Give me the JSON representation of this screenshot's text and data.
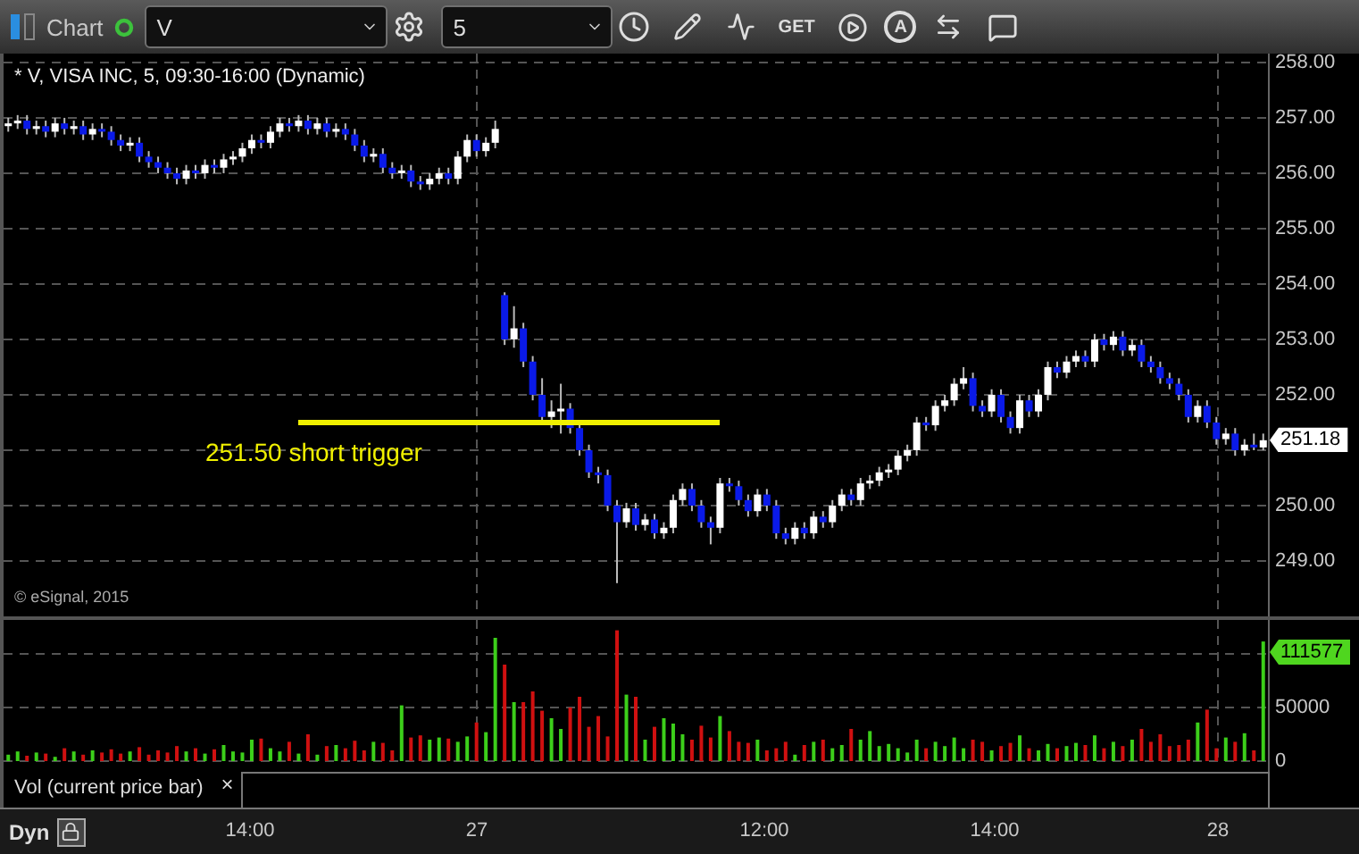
{
  "toolbar": {
    "title": "Chart",
    "connected": true,
    "symbol": "V",
    "interval": "5",
    "get_label": "GET",
    "alert_label": "A"
  },
  "chart": {
    "title": "* V, VISA INC, 5, 09:30-16:00 (Dynamic)",
    "copyright": "© eSignal, 2015",
    "annotation": "251.50 short trigger",
    "last_price": "251.18",
    "chart_data": {
      "type": "candlestick",
      "ylim": [
        248,
        258.16
      ],
      "grid": true,
      "yticks": [
        {
          "value": 258,
          "label": "258.00"
        },
        {
          "value": 257,
          "label": "257.00"
        },
        {
          "value": 256,
          "label": "256.00"
        },
        {
          "value": 255,
          "label": "255.00"
        },
        {
          "value": 254,
          "label": "254.00"
        },
        {
          "value": 253,
          "label": "253.00"
        },
        {
          "value": 252,
          "label": "252.00"
        },
        {
          "value": 250,
          "label": "250.00"
        },
        {
          "value": 249,
          "label": "249.00"
        }
      ],
      "categories": [
        null,
        null,
        null,
        null,
        null,
        null,
        null,
        null,
        null,
        null,
        null,
        null,
        null,
        null,
        null,
        null,
        null,
        null,
        null,
        null,
        null,
        null,
        null,
        null,
        null,
        null,
        null,
        null,
        null,
        null,
        null,
        null,
        null,
        null,
        null,
        null,
        null,
        null,
        null,
        null,
        null,
        null,
        null,
        null,
        null,
        null,
        null,
        null,
        null,
        null,
        null,
        null,
        null,
        null,
        null,
        null,
        null,
        null,
        null,
        null,
        null,
        null,
        null,
        null,
        null,
        null,
        null,
        null,
        null,
        null,
        null,
        null,
        null,
        null,
        null,
        null,
        null,
        null,
        null,
        null,
        null,
        null,
        null,
        null,
        null,
        null,
        null,
        null,
        null,
        null,
        null,
        null,
        null,
        null,
        null,
        null,
        null,
        null,
        null,
        null,
        null,
        null,
        null,
        null,
        null,
        null,
        null,
        null,
        null,
        null,
        null,
        null,
        null,
        null,
        null,
        null,
        null,
        null,
        null,
        null,
        null,
        null,
        null,
        null,
        null,
        null,
        null,
        null,
        null,
        null,
        null,
        null,
        null,
        null,
        null
      ],
      "ohlc": [
        [
          256.85,
          257.0,
          256.75,
          256.9
        ],
        [
          256.9,
          257.05,
          256.8,
          256.95
        ],
        [
          256.95,
          257.05,
          256.7,
          256.8
        ],
        [
          256.8,
          256.95,
          256.7,
          256.85
        ],
        [
          256.85,
          256.95,
          256.65,
          256.75
        ],
        [
          256.75,
          257.0,
          256.65,
          256.9
        ],
        [
          256.9,
          257.0,
          256.7,
          256.8
        ],
        [
          256.8,
          256.95,
          256.7,
          256.85
        ],
        [
          256.85,
          256.95,
          256.6,
          256.7
        ],
        [
          256.7,
          256.9,
          256.6,
          256.8
        ],
        [
          256.8,
          256.9,
          256.65,
          256.75
        ],
        [
          256.75,
          256.85,
          256.5,
          256.6
        ],
        [
          256.6,
          256.7,
          256.4,
          256.5
        ],
        [
          256.5,
          256.65,
          256.4,
          256.55
        ],
        [
          256.55,
          256.65,
          256.2,
          256.3
        ],
        [
          256.3,
          256.4,
          256.1,
          256.2
        ],
        [
          256.2,
          256.3,
          256.0,
          256.1
        ],
        [
          256.1,
          256.2,
          255.9,
          256.0
        ],
        [
          256.0,
          256.1,
          255.8,
          255.9
        ],
        [
          255.9,
          256.15,
          255.8,
          256.05
        ],
        [
          256.05,
          256.15,
          255.9,
          256.0
        ],
        [
          256.0,
          256.25,
          255.9,
          256.15
        ],
        [
          256.15,
          256.25,
          256.0,
          256.1
        ],
        [
          256.1,
          256.35,
          256.0,
          256.25
        ],
        [
          256.25,
          256.4,
          256.15,
          256.3
        ],
        [
          256.3,
          256.55,
          256.2,
          256.45
        ],
        [
          256.45,
          256.7,
          256.35,
          256.6
        ],
        [
          256.6,
          256.7,
          256.45,
          256.55
        ],
        [
          256.55,
          256.85,
          256.45,
          256.75
        ],
        [
          256.75,
          257.0,
          256.65,
          256.9
        ],
        [
          256.9,
          257.0,
          256.75,
          256.85
        ],
        [
          256.85,
          257.05,
          256.75,
          256.95
        ],
        [
          256.95,
          257.05,
          256.7,
          256.8
        ],
        [
          256.8,
          257.0,
          256.7,
          256.9
        ],
        [
          256.9,
          257.0,
          256.65,
          256.75
        ],
        [
          256.75,
          256.9,
          256.65,
          256.8
        ],
        [
          256.8,
          256.9,
          256.6,
          256.7
        ],
        [
          256.7,
          256.8,
          256.4,
          256.5
        ],
        [
          256.5,
          256.6,
          256.2,
          256.3
        ],
        [
          256.3,
          256.45,
          256.2,
          256.35
        ],
        [
          256.35,
          256.45,
          256.0,
          256.1
        ],
        [
          256.1,
          256.2,
          255.9,
          256.0
        ],
        [
          256.0,
          256.15,
          255.9,
          256.05
        ],
        [
          256.05,
          256.15,
          255.75,
          255.85
        ],
        [
          255.85,
          255.95,
          255.7,
          255.8
        ],
        [
          255.8,
          256.0,
          255.7,
          255.9
        ],
        [
          255.9,
          256.1,
          255.8,
          256.0
        ],
        [
          256.0,
          256.1,
          255.8,
          255.9
        ],
        [
          255.9,
          256.4,
          255.8,
          256.3
        ],
        [
          256.3,
          256.7,
          256.2,
          256.6
        ],
        [
          256.6,
          256.7,
          256.3,
          256.4
        ],
        [
          256.4,
          256.65,
          256.3,
          256.55
        ],
        [
          256.55,
          256.95,
          256.45,
          256.8
        ],
        [
          253.8,
          253.85,
          252.9,
          253.0
        ],
        [
          253.0,
          253.6,
          252.85,
          253.2
        ],
        [
          253.2,
          253.3,
          252.5,
          252.6
        ],
        [
          252.6,
          252.7,
          251.9,
          252.0
        ],
        [
          252.0,
          252.3,
          251.5,
          251.6
        ],
        [
          251.6,
          251.9,
          251.4,
          251.7
        ],
        [
          251.7,
          252.2,
          251.3,
          251.75
        ],
        [
          251.75,
          251.85,
          251.3,
          251.4
        ],
        [
          251.4,
          251.5,
          250.9,
          251.0
        ],
        [
          251.0,
          251.1,
          250.5,
          250.6
        ],
        [
          250.6,
          250.7,
          250.4,
          250.55
        ],
        [
          250.55,
          250.65,
          249.9,
          250.0
        ],
        [
          250.0,
          250.1,
          248.6,
          249.7
        ],
        [
          249.7,
          250.05,
          249.6,
          249.95
        ],
        [
          249.95,
          250.05,
          249.55,
          249.65
        ],
        [
          249.65,
          249.85,
          249.55,
          249.75
        ],
        [
          249.75,
          249.85,
          249.4,
          249.5
        ],
        [
          249.5,
          249.7,
          249.4,
          249.6
        ],
        [
          249.6,
          250.2,
          249.5,
          250.1
        ],
        [
          250.1,
          250.4,
          250.0,
          250.3
        ],
        [
          250.3,
          250.4,
          249.9,
          250.0
        ],
        [
          250.0,
          250.1,
          249.6,
          249.7
        ],
        [
          249.7,
          249.8,
          249.3,
          249.6
        ],
        [
          249.6,
          250.5,
          249.5,
          250.4
        ],
        [
          250.4,
          250.5,
          250.25,
          250.35
        ],
        [
          250.35,
          250.45,
          250.0,
          250.1
        ],
        [
          250.1,
          250.2,
          249.8,
          249.9
        ],
        [
          249.9,
          250.3,
          249.8,
          250.2
        ],
        [
          250.2,
          250.3,
          249.9,
          250.0
        ],
        [
          250.0,
          250.1,
          249.4,
          249.5
        ],
        [
          249.5,
          249.6,
          249.3,
          249.4
        ],
        [
          249.4,
          249.7,
          249.3,
          249.6
        ],
        [
          249.6,
          249.7,
          249.4,
          249.5
        ],
        [
          249.5,
          249.9,
          249.4,
          249.8
        ],
        [
          249.8,
          249.9,
          249.6,
          249.7
        ],
        [
          249.7,
          250.1,
          249.6,
          250.0
        ],
        [
          250.0,
          250.3,
          249.9,
          250.2
        ],
        [
          250.2,
          250.3,
          250.0,
          250.1
        ],
        [
          250.1,
          250.5,
          250.0,
          250.4
        ],
        [
          250.4,
          250.55,
          250.3,
          250.45
        ],
        [
          250.45,
          250.7,
          250.35,
          250.6
        ],
        [
          250.6,
          250.75,
          250.5,
          250.65
        ],
        [
          250.65,
          251.0,
          250.55,
          250.9
        ],
        [
          250.9,
          251.1,
          250.8,
          251.0
        ],
        [
          251.0,
          251.6,
          250.9,
          251.5
        ],
        [
          251.5,
          251.6,
          251.35,
          251.45
        ],
        [
          251.45,
          251.9,
          251.35,
          251.8
        ],
        [
          251.8,
          252.0,
          251.7,
          251.9
        ],
        [
          251.9,
          252.3,
          251.8,
          252.2
        ],
        [
          252.2,
          252.5,
          252.1,
          252.3
        ],
        [
          252.3,
          252.4,
          251.7,
          251.8
        ],
        [
          251.8,
          251.9,
          251.6,
          251.7
        ],
        [
          251.7,
          252.1,
          251.6,
          252.0
        ],
        [
          252.0,
          252.1,
          251.5,
          251.6
        ],
        [
          251.6,
          251.7,
          251.3,
          251.4
        ],
        [
          251.4,
          252.0,
          251.3,
          251.9
        ],
        [
          251.9,
          252.0,
          251.6,
          251.7
        ],
        [
          251.7,
          252.1,
          251.6,
          252.0
        ],
        [
          252.0,
          252.6,
          251.9,
          252.5
        ],
        [
          252.5,
          252.6,
          252.3,
          252.4
        ],
        [
          252.4,
          252.7,
          252.3,
          252.6
        ],
        [
          252.6,
          252.8,
          252.5,
          252.7
        ],
        [
          252.7,
          252.8,
          252.5,
          252.6
        ],
        [
          252.6,
          253.1,
          252.5,
          253.0
        ],
        [
          253.0,
          253.1,
          252.8,
          252.9
        ],
        [
          252.9,
          253.15,
          252.8,
          253.05
        ],
        [
          253.05,
          253.15,
          252.7,
          252.8
        ],
        [
          252.8,
          253.0,
          252.7,
          252.9
        ],
        [
          252.9,
          253.0,
          252.5,
          252.6
        ],
        [
          252.6,
          252.7,
          252.4,
          252.5
        ],
        [
          252.5,
          252.6,
          252.2,
          252.3
        ],
        [
          252.3,
          252.4,
          252.1,
          252.2
        ],
        [
          252.2,
          252.3,
          251.9,
          252.0
        ],
        [
          252.0,
          252.1,
          251.5,
          251.6
        ],
        [
          251.6,
          251.9,
          251.5,
          251.8
        ],
        [
          251.8,
          251.9,
          251.4,
          251.5
        ],
        [
          251.5,
          251.6,
          251.1,
          251.2
        ],
        [
          251.2,
          251.4,
          251.1,
          251.3
        ],
        [
          251.3,
          251.4,
          250.9,
          251.0
        ],
        [
          251.0,
          251.2,
          250.9,
          251.1
        ],
        [
          251.1,
          251.3,
          251.0,
          251.05
        ],
        [
          251.05,
          251.3,
          251.0,
          251.18
        ]
      ]
    }
  },
  "volume": {
    "last_volume": "111577",
    "chart_data": {
      "type": "bar",
      "ylim": [
        0,
        131667
      ],
      "yticks": [
        50000,
        0
      ],
      "grid": true,
      "categories": [
        null,
        null,
        null,
        null,
        null,
        null,
        null,
        null,
        null,
        null,
        null,
        null,
        null,
        null,
        null,
        null,
        null,
        null,
        null,
        null,
        null,
        null,
        null,
        null,
        null,
        null,
        null,
        null,
        null,
        null,
        null,
        null,
        null,
        null,
        null,
        null,
        null,
        null,
        null,
        null,
        null,
        null,
        null,
        null,
        null,
        null,
        null,
        null,
        null,
        null,
        null,
        null,
        null,
        null,
        null,
        null,
        null,
        null,
        null,
        null,
        null,
        null,
        null,
        null,
        null,
        null,
        null,
        null,
        null,
        null,
        null,
        null,
        null,
        null,
        null,
        null,
        null,
        null,
        null,
        null,
        null,
        null,
        null,
        null,
        null,
        null,
        null,
        null,
        null,
        null,
        null,
        null,
        null,
        null,
        null,
        null,
        null,
        null,
        null,
        null,
        null,
        null,
        null,
        null,
        null,
        null,
        null,
        null,
        null,
        null,
        null,
        null,
        null,
        null,
        null,
        null,
        null,
        null,
        null,
        null,
        null,
        null,
        null,
        null,
        null,
        null,
        null,
        null,
        null,
        null,
        null,
        null,
        null,
        null,
        null
      ],
      "values": [
        6000,
        9000,
        5000,
        8000,
        7000,
        4000,
        12000,
        9000,
        6000,
        10000,
        8000,
        11000,
        7000,
        9000,
        13000,
        6000,
        10000,
        8000,
        14000,
        9000,
        12000,
        7000,
        11000,
        15000,
        9000,
        8000,
        20000,
        21000,
        12000,
        9000,
        18000,
        7000,
        25000,
        6000,
        14000,
        15000,
        12000,
        19000,
        10000,
        18000,
        17000,
        10000,
        52000,
        22000,
        24000,
        20000,
        22000,
        21000,
        18000,
        23000,
        36000,
        27000,
        115000,
        90000,
        55000,
        55000,
        65000,
        47000,
        40000,
        30000,
        50000,
        60000,
        32000,
        42000,
        23000,
        122000,
        62000,
        60000,
        20000,
        32000,
        40000,
        35000,
        25000,
        20000,
        33000,
        22000,
        42000,
        28000,
        18000,
        17000,
        20000,
        10000,
        12000,
        18000,
        6000,
        15000,
        18000,
        20000,
        12000,
        15000,
        30000,
        20000,
        28000,
        14000,
        16000,
        12000,
        8000,
        20000,
        12000,
        18000,
        14000,
        22000,
        12000,
        20000,
        18000,
        10000,
        14000,
        17000,
        24000,
        12000,
        10000,
        16000,
        12000,
        14000,
        17000,
        15000,
        24000,
        12000,
        18000,
        14000,
        20000,
        30000,
        18000,
        25000,
        14000,
        15000,
        20000,
        36000,
        48000,
        12000,
        22000,
        18000,
        26000,
        10000,
        111577
      ]
    },
    "study_label": "Vol (current price bar)",
    "close": "×"
  },
  "time_axis": {
    "mode": "Dyn",
    "labels": [
      "14:00",
      "27",
      "12:00",
      "14:00",
      "28"
    ]
  }
}
